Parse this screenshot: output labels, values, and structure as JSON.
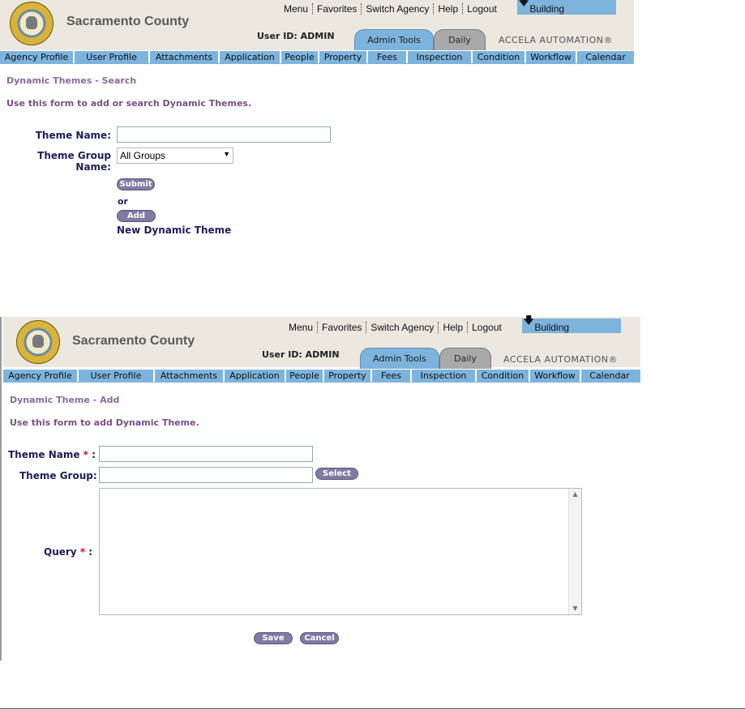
{
  "header": {
    "county": "Sacramento County",
    "top_nav": [
      "Menu",
      "Favorites",
      "Switch Agency",
      "Help",
      "Logout"
    ],
    "module": "Building",
    "user_id": "User ID: ADMIN",
    "tabs": [
      {
        "label": "Admin Tools",
        "active": true
      },
      {
        "label": "Daily",
        "active": false
      }
    ],
    "brand": "ACCELA AUTOMATION®",
    "nav": [
      "Agency Profile",
      "User Profile",
      "Attachments",
      "Application",
      "People",
      "Property",
      "Fees",
      "Inspection",
      "Condition",
      "Workflow",
      "Calendar"
    ]
  },
  "search_form": {
    "title": "Dynamic Themes - Search",
    "description": "Use this form to add or search Dynamic Themes.",
    "theme_name_label": "Theme Name:",
    "theme_name_value": "",
    "theme_group_label": "Theme Group Name:",
    "theme_group_selected": "All Groups",
    "submit_label": "Submit",
    "or_label": "or",
    "add_label": "Add",
    "new_theme_label": "New Dynamic Theme"
  },
  "add_form": {
    "title": "Dynamic Theme - Add",
    "description": "Use this form to add Dynamic Theme.",
    "theme_name_label": "Theme Name",
    "theme_group_label": "Theme Group:",
    "query_label": "Query",
    "required_marker": "*",
    "colon": ":",
    "select_label": "Select",
    "save_label": "Save",
    "cancel_label": "Cancel"
  },
  "colors": {
    "nav_blue": "#7db4dd",
    "header_bg": "#ece8df",
    "pill_purple": "#817aa2",
    "title_purple": "#8a6a98",
    "label_navy": "#1d1d5a",
    "required_red": "#d0102a"
  }
}
